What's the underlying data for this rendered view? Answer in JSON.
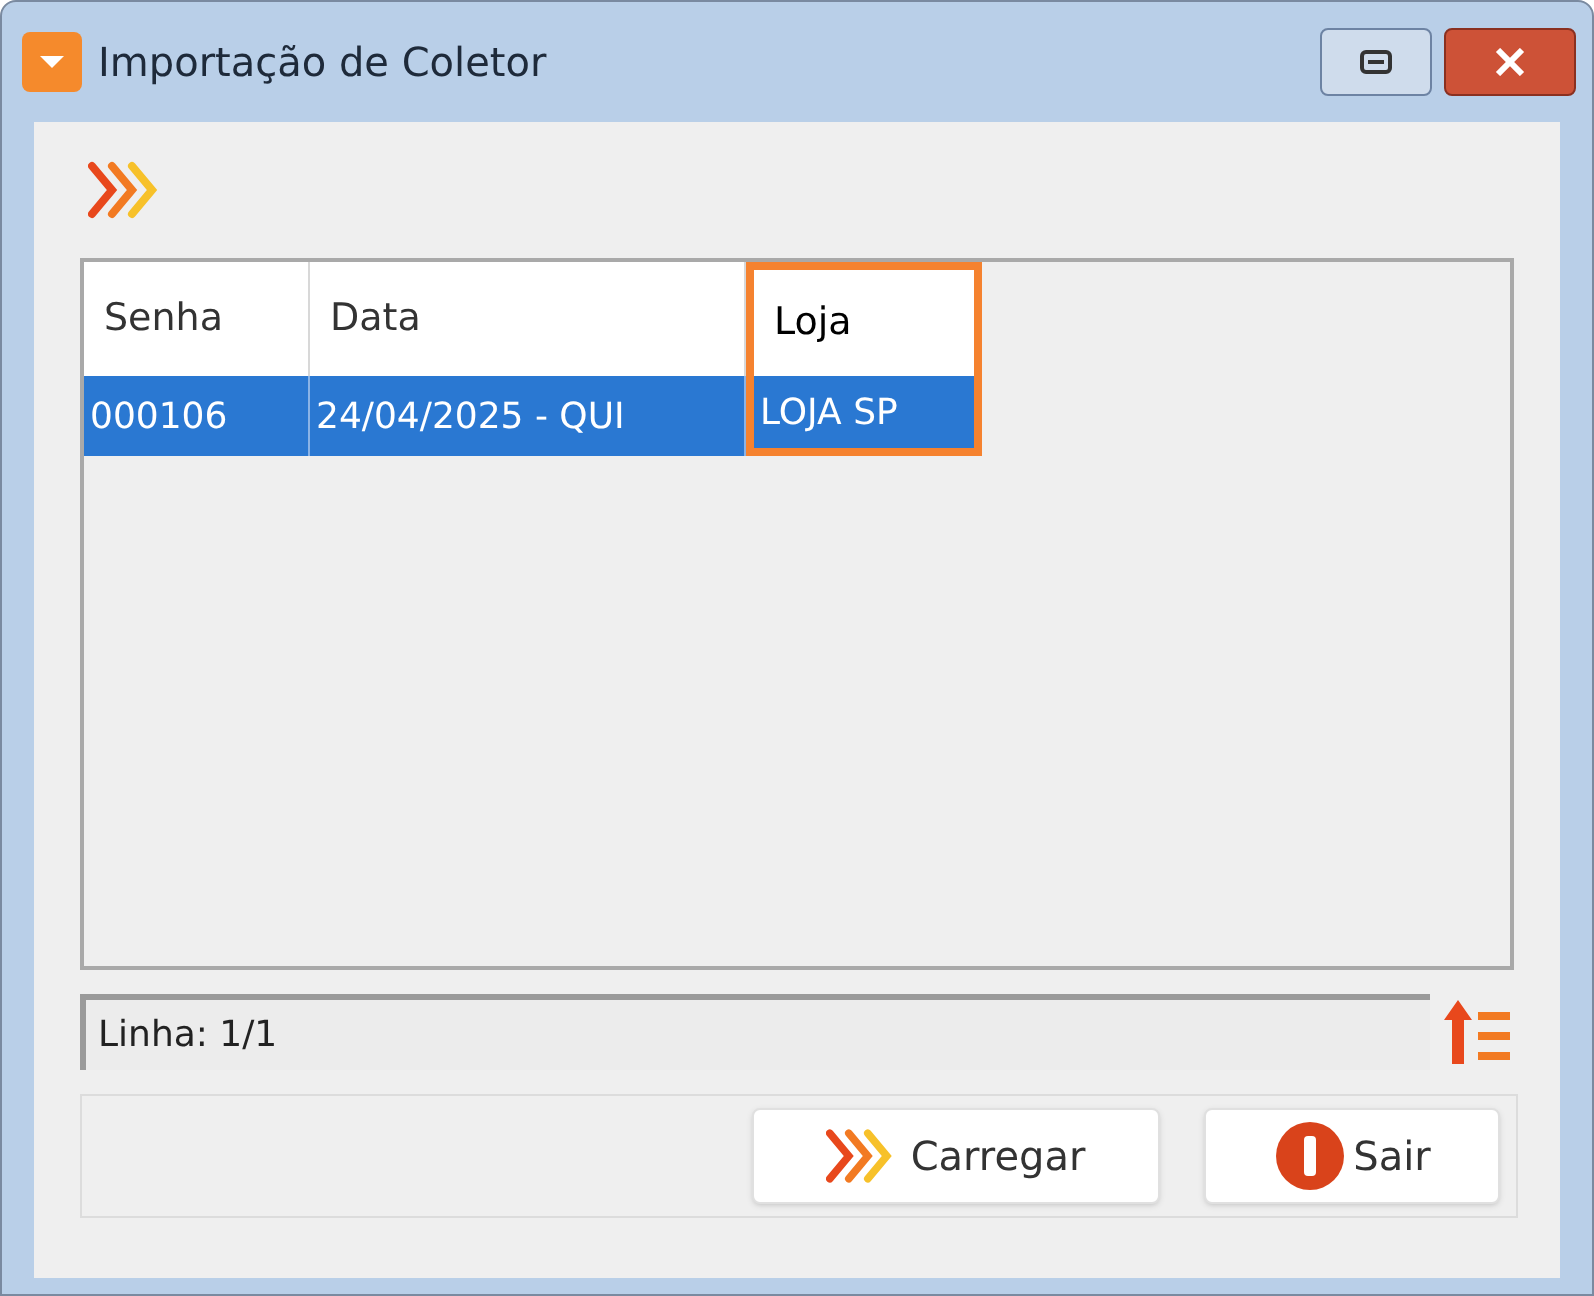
{
  "window": {
    "title": "Importação de Coletor"
  },
  "table": {
    "columns": [
      {
        "label": "Senha",
        "highlighted": false
      },
      {
        "label": "Data",
        "highlighted": false
      },
      {
        "label": "Loja",
        "highlighted": true
      }
    ],
    "rows": [
      {
        "cells": [
          "000106",
          "24/04/2025 - QUI",
          "LOJA SP"
        ],
        "selected": true
      }
    ]
  },
  "status_field": {
    "value": "Linha: 1/1"
  },
  "buttons": [
    {
      "kind": "load",
      "label": "Carregar"
    },
    {
      "kind": "exit",
      "label": "Sair"
    }
  ]
}
